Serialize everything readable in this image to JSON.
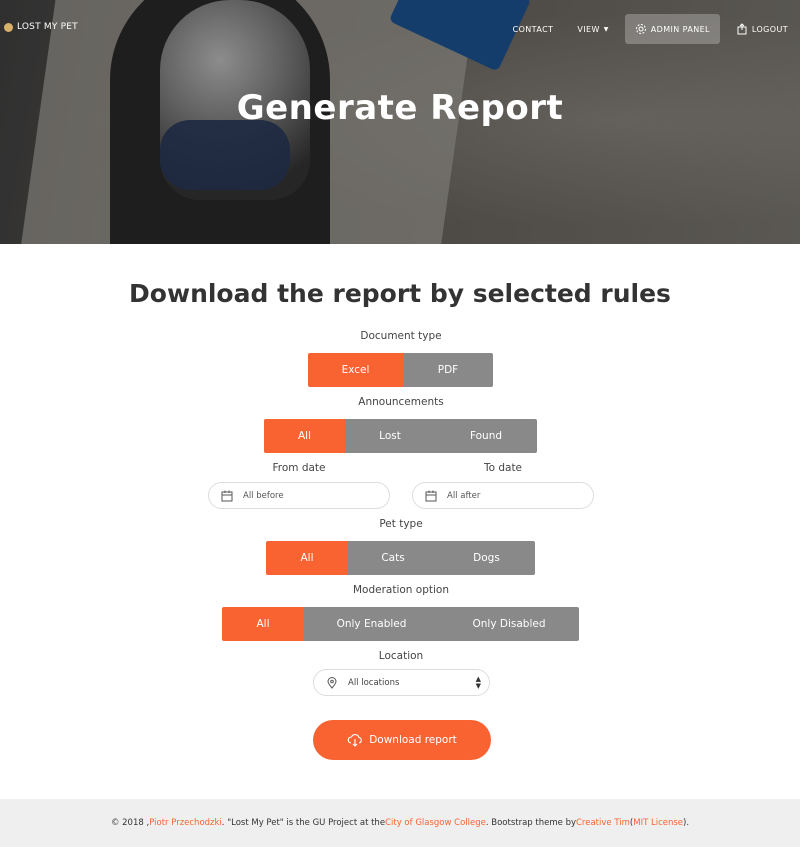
{
  "brand": {
    "name": "LOST MY PET"
  },
  "nav": {
    "contact": "CONTACT",
    "view": "VIEW",
    "admin": "ADMIN PANEL",
    "logout": "LOGOUT"
  },
  "hero": {
    "title": "Generate Report"
  },
  "main": {
    "title": "Download the report by selected rules",
    "document_type": {
      "label": "Document type",
      "options": [
        "Excel",
        "PDF"
      ],
      "selected": "Excel"
    },
    "announcements": {
      "label": "Announcements",
      "options": [
        "All",
        "Lost",
        "Found"
      ],
      "selected": "All"
    },
    "from_date": {
      "label": "From date",
      "value": "All before"
    },
    "to_date": {
      "label": "To date",
      "value": "All after"
    },
    "pet_type": {
      "label": "Pet type",
      "options": [
        "All",
        "Cats",
        "Dogs"
      ],
      "selected": "All"
    },
    "moderation": {
      "label": "Moderation option",
      "options": [
        "All",
        "Only Enabled",
        "Only Disabled"
      ],
      "selected": "All"
    },
    "location": {
      "label": "Location",
      "value": "All locations"
    },
    "download_button": "Download report"
  },
  "footer": {
    "prefix": "© 2018 , ",
    "author": "Piotr Przechodzki",
    "mid1": ". \"Lost My Pet\" is the GU Project at the ",
    "college": "City of Glasgow College",
    "mid2": ". Bootstrap theme by ",
    "theme_author": "Creative Tim",
    "mid3": " (",
    "license": "MIT License",
    "suffix": ")."
  },
  "colors": {
    "accent": "#f96332",
    "inactive": "#898989",
    "footer_bg": "#efefef"
  },
  "icons": [
    "calendar-icon",
    "location-pin-icon",
    "settings-icon",
    "logout-icon",
    "cloud-download-icon",
    "select-arrows-icon"
  ]
}
